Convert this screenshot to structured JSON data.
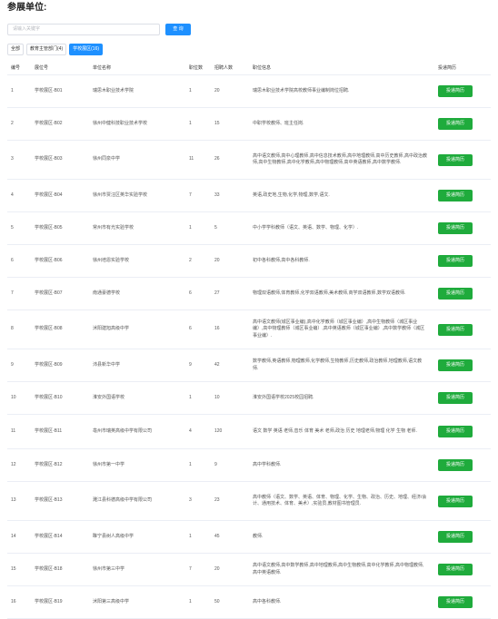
{
  "page": {
    "title": "参展单位:"
  },
  "search": {
    "placeholder": "请输入关键字",
    "value": "",
    "button_label": "查 询"
  },
  "tabs": [
    {
      "label": "全部",
      "active": false
    },
    {
      "label": "教育主管部门(4)",
      "active": false
    },
    {
      "label": "学校展区(16)",
      "active": true
    }
  ],
  "table": {
    "headers": {
      "no": "编号",
      "booth": "展位号",
      "unit": "单位名称",
      "positions": "职位数",
      "recruits": "招聘人数",
      "info": "职位信息",
      "action": "投递简历"
    },
    "action_label": "投递简历",
    "rows": [
      {
        "no": "1",
        "booth": "学校展区-B01",
        "unit": "瑞思木职业技术学院",
        "positions": "1",
        "recruits": "20",
        "info": "瑞思木职业技术学院高校教师事业编制岗位招聘."
      },
      {
        "no": "2",
        "booth": "学校展区-B02",
        "unit": "徐州中健科技职业技术学校",
        "positions": "1",
        "recruits": "15",
        "info": "中职学校教师、班主任岗."
      },
      {
        "no": "3",
        "booth": "学校展区-B03",
        "unit": "徐州同泉中学",
        "positions": "11",
        "recruits": "26",
        "info": "高中语文教师,高中心理教师,高中信息技术教师,高中地理教师,高中历史教师,高中政治教师,高中生物教师,高中化学教师,高中物理教师,高中英语教师,高中数学教师."
      },
      {
        "no": "4",
        "booth": "学校展区-B04",
        "unit": "徐州市贾汪区英华实验学校",
        "positions": "7",
        "recruits": "33",
        "info": "英语,政史地,生物,化学,物理,数学,语文."
      },
      {
        "no": "5",
        "booth": "学校展区-B05",
        "unit": "常州市有光实验学校",
        "positions": "1",
        "recruits": "5",
        "info": "中小学学科教师（语文、英语、数学、物理、化学）."
      },
      {
        "no": "6",
        "booth": "学校展区-B06",
        "unit": "徐州培恩实验学校",
        "positions": "2",
        "recruits": "20",
        "info": "初中各科教师,高中各科教师."
      },
      {
        "no": "7",
        "booth": "学校展区-B07",
        "unit": "南通豪德学校",
        "positions": "6",
        "recruits": "27",
        "info": "物理双语教师,体育教师,化学双语教师,美术教师,商学双语教师,数学双语教师."
      },
      {
        "no": "8",
        "booth": "学校展区-B08",
        "unit": "沭阳建旭高级中学",
        "positions": "6",
        "recruits": "16",
        "info": "高中语文教师(城区事业编),高中化学教师（城区事业编）,高中生物教师（城区事业编）,高中物理教师（城区事业编）,高中英语教师（城区事业编）,高中数学教师（城区事业编）."
      },
      {
        "no": "9",
        "booth": "学校展区-B09",
        "unit": "沛县新华中学",
        "positions": "9",
        "recruits": "42",
        "info": "数学教师,英语教师,物理教师,化学教师,生物教师,历史教师,政治教师,地理教师,语文教师."
      },
      {
        "no": "10",
        "booth": "学校展区-B10",
        "unit": "淮安外国语学校",
        "positions": "1",
        "recruits": "10",
        "info": "淮安外国语学校2025校园招聘."
      },
      {
        "no": "11",
        "booth": "学校展区-B11",
        "unit": "亳州市瑞英高级中学有限公司",
        "positions": "4",
        "recruits": "120",
        "info": "语文 数学 英语 老师,音乐 体育 美术 老师,政治 历史 地理老师,物理 化学 生物 老师."
      },
      {
        "no": "12",
        "booth": "学校展区-B12",
        "unit": "徐州市第一中学",
        "positions": "1",
        "recruits": "9",
        "info": "高中学科教师."
      },
      {
        "no": "13",
        "booth": "学校展区-B13",
        "unit": "濉江县科德高级中学有限公司",
        "positions": "3",
        "recruits": "23",
        "info": "高中教师（语文、数学、英语、体育、物理、化学、生物、政治、历史、地理、经济/会计、通用技术、体育、美术）,实验员,教材图书管理员."
      },
      {
        "no": "14",
        "booth": "学校展区-B14",
        "unit": "睢宁县树人高级中学",
        "positions": "1",
        "recruits": "45",
        "info": "教师."
      },
      {
        "no": "15",
        "booth": "学校展区-B18",
        "unit": "徐州市第三中学",
        "positions": "7",
        "recruits": "20",
        "info": "高中语文教师,高中数学教师,高中地理教师,高中生物教师,高中化学教师,高中物理教师,高中英语教师."
      },
      {
        "no": "16",
        "booth": "学校展区-B19",
        "unit": "沭阳第三高级中学",
        "positions": "1",
        "recruits": "50",
        "info": "高中各科教师."
      }
    ]
  }
}
